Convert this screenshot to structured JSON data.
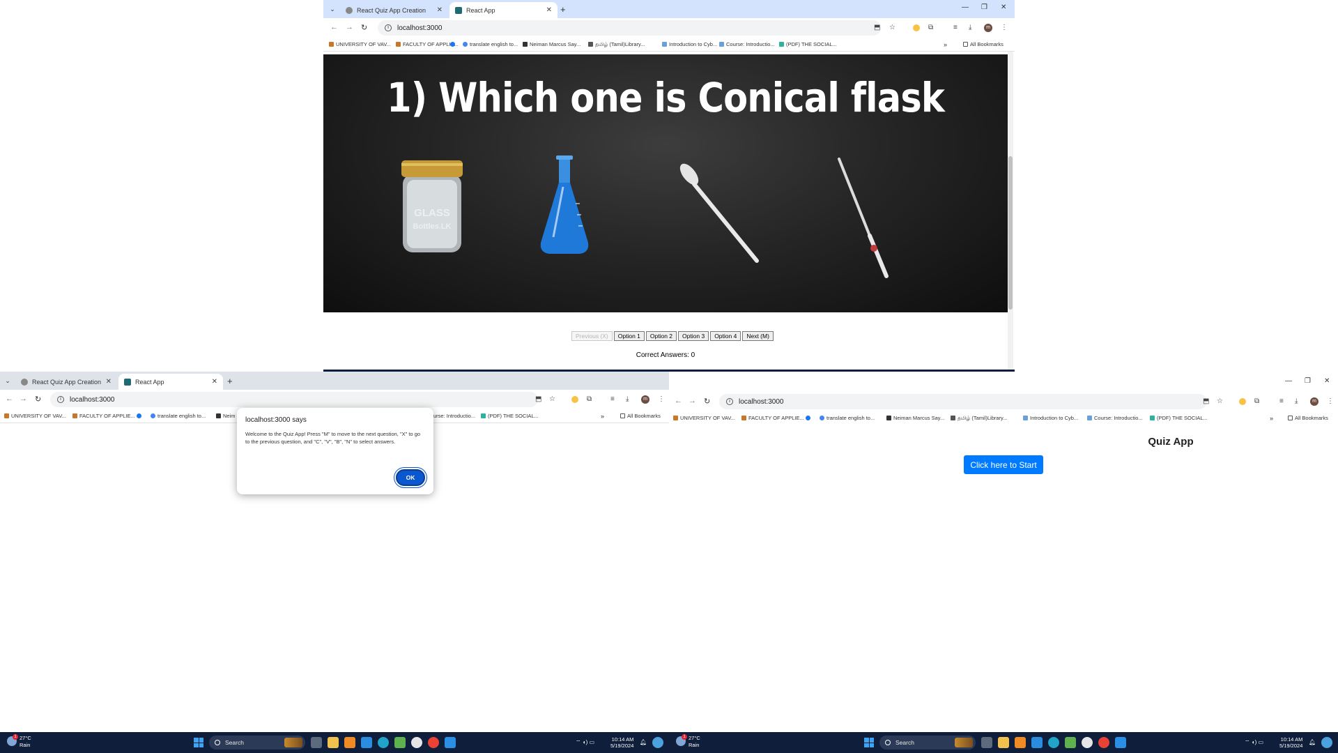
{
  "tabs": [
    {
      "title": "React Quiz App Creation"
    },
    {
      "title": "React App"
    }
  ],
  "address": "localhost:3000",
  "bookmarks": [
    "UNIVERSITY OF VAV...",
    "FACULTY OF APPLIE...",
    "translate english to...",
    "Neiman Marcus Say...",
    "தமிழ் (Tamil)Library...",
    "Introduction to Cyb...",
    "Course: Introductio...",
    "(PDF) THE SOCIAL..."
  ],
  "bookmarks_dialog": [
    "UNIVERSITY OF VAV...",
    "FACULTY OF APPLIE...",
    "translate english to...",
    "Neim",
    "urse: Introductio...",
    "(PDF) THE SOCIAL..."
  ],
  "all_bookmarks": "All Bookmarks",
  "more_bookmarks": "»",
  "quiz": {
    "question": "1) Which one is Conical flask",
    "image_text": "GLASS Bottles.LK",
    "buttons": [
      "Previous (X)",
      "Option 1",
      "Option 2",
      "Option 3",
      "Option 4",
      "Next (M)"
    ],
    "correct_label": "Correct Answers: 0"
  },
  "dialog": {
    "title": "localhost:3000 says",
    "message": "Welcome to the Quiz App! Press \"M\" to move to the next question, \"X\" to go to the previous question, and \"C\", \"V\", \"B\", \"N\" to select answers.",
    "ok": "OK"
  },
  "home": {
    "title": "Quiz App",
    "start": "Click here to Start"
  },
  "taskbar": {
    "temp": "27°C",
    "weather": "Rain",
    "weather_badge": "1",
    "search": "Search",
    "time": "10:14 AM",
    "date": "5/19/2024"
  },
  "colors": {
    "tabstrip": "#d3e3fd",
    "taskbar": "#0f1e3a",
    "start_button": "#007bff",
    "ok_button": "#0b57d0"
  }
}
